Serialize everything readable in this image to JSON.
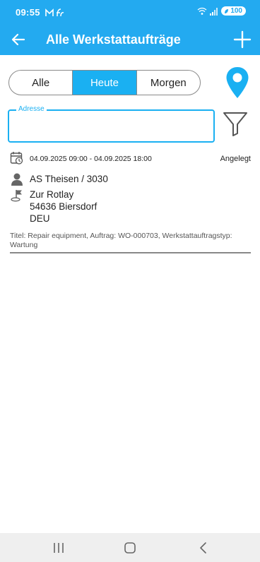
{
  "status_bar": {
    "time": "09:55",
    "battery": "100",
    "accent": "#23aaf0"
  },
  "app_bar": {
    "title": "Alle Werkstattaufträge",
    "back_icon": "arrow-left-icon",
    "add_icon": "plus-icon"
  },
  "filter_tabs": {
    "items": [
      "Alle",
      "Heute",
      "Morgen"
    ],
    "selected": "Heute"
  },
  "address_field": {
    "label": "Adresse",
    "value": ""
  },
  "orders": [
    {
      "date_range": "04.09.2025 09:00 - 04.09.2025 18:00",
      "status": "Angelegt",
      "person": "AS Theisen / 3030",
      "street": "Zur Rotlay",
      "city": "54636 Biersdorf",
      "country": "DEU",
      "description": "Titel: Repair equipment, Auftrag: WO-000703, Werkstattauftragstyp: Wartung"
    }
  ]
}
